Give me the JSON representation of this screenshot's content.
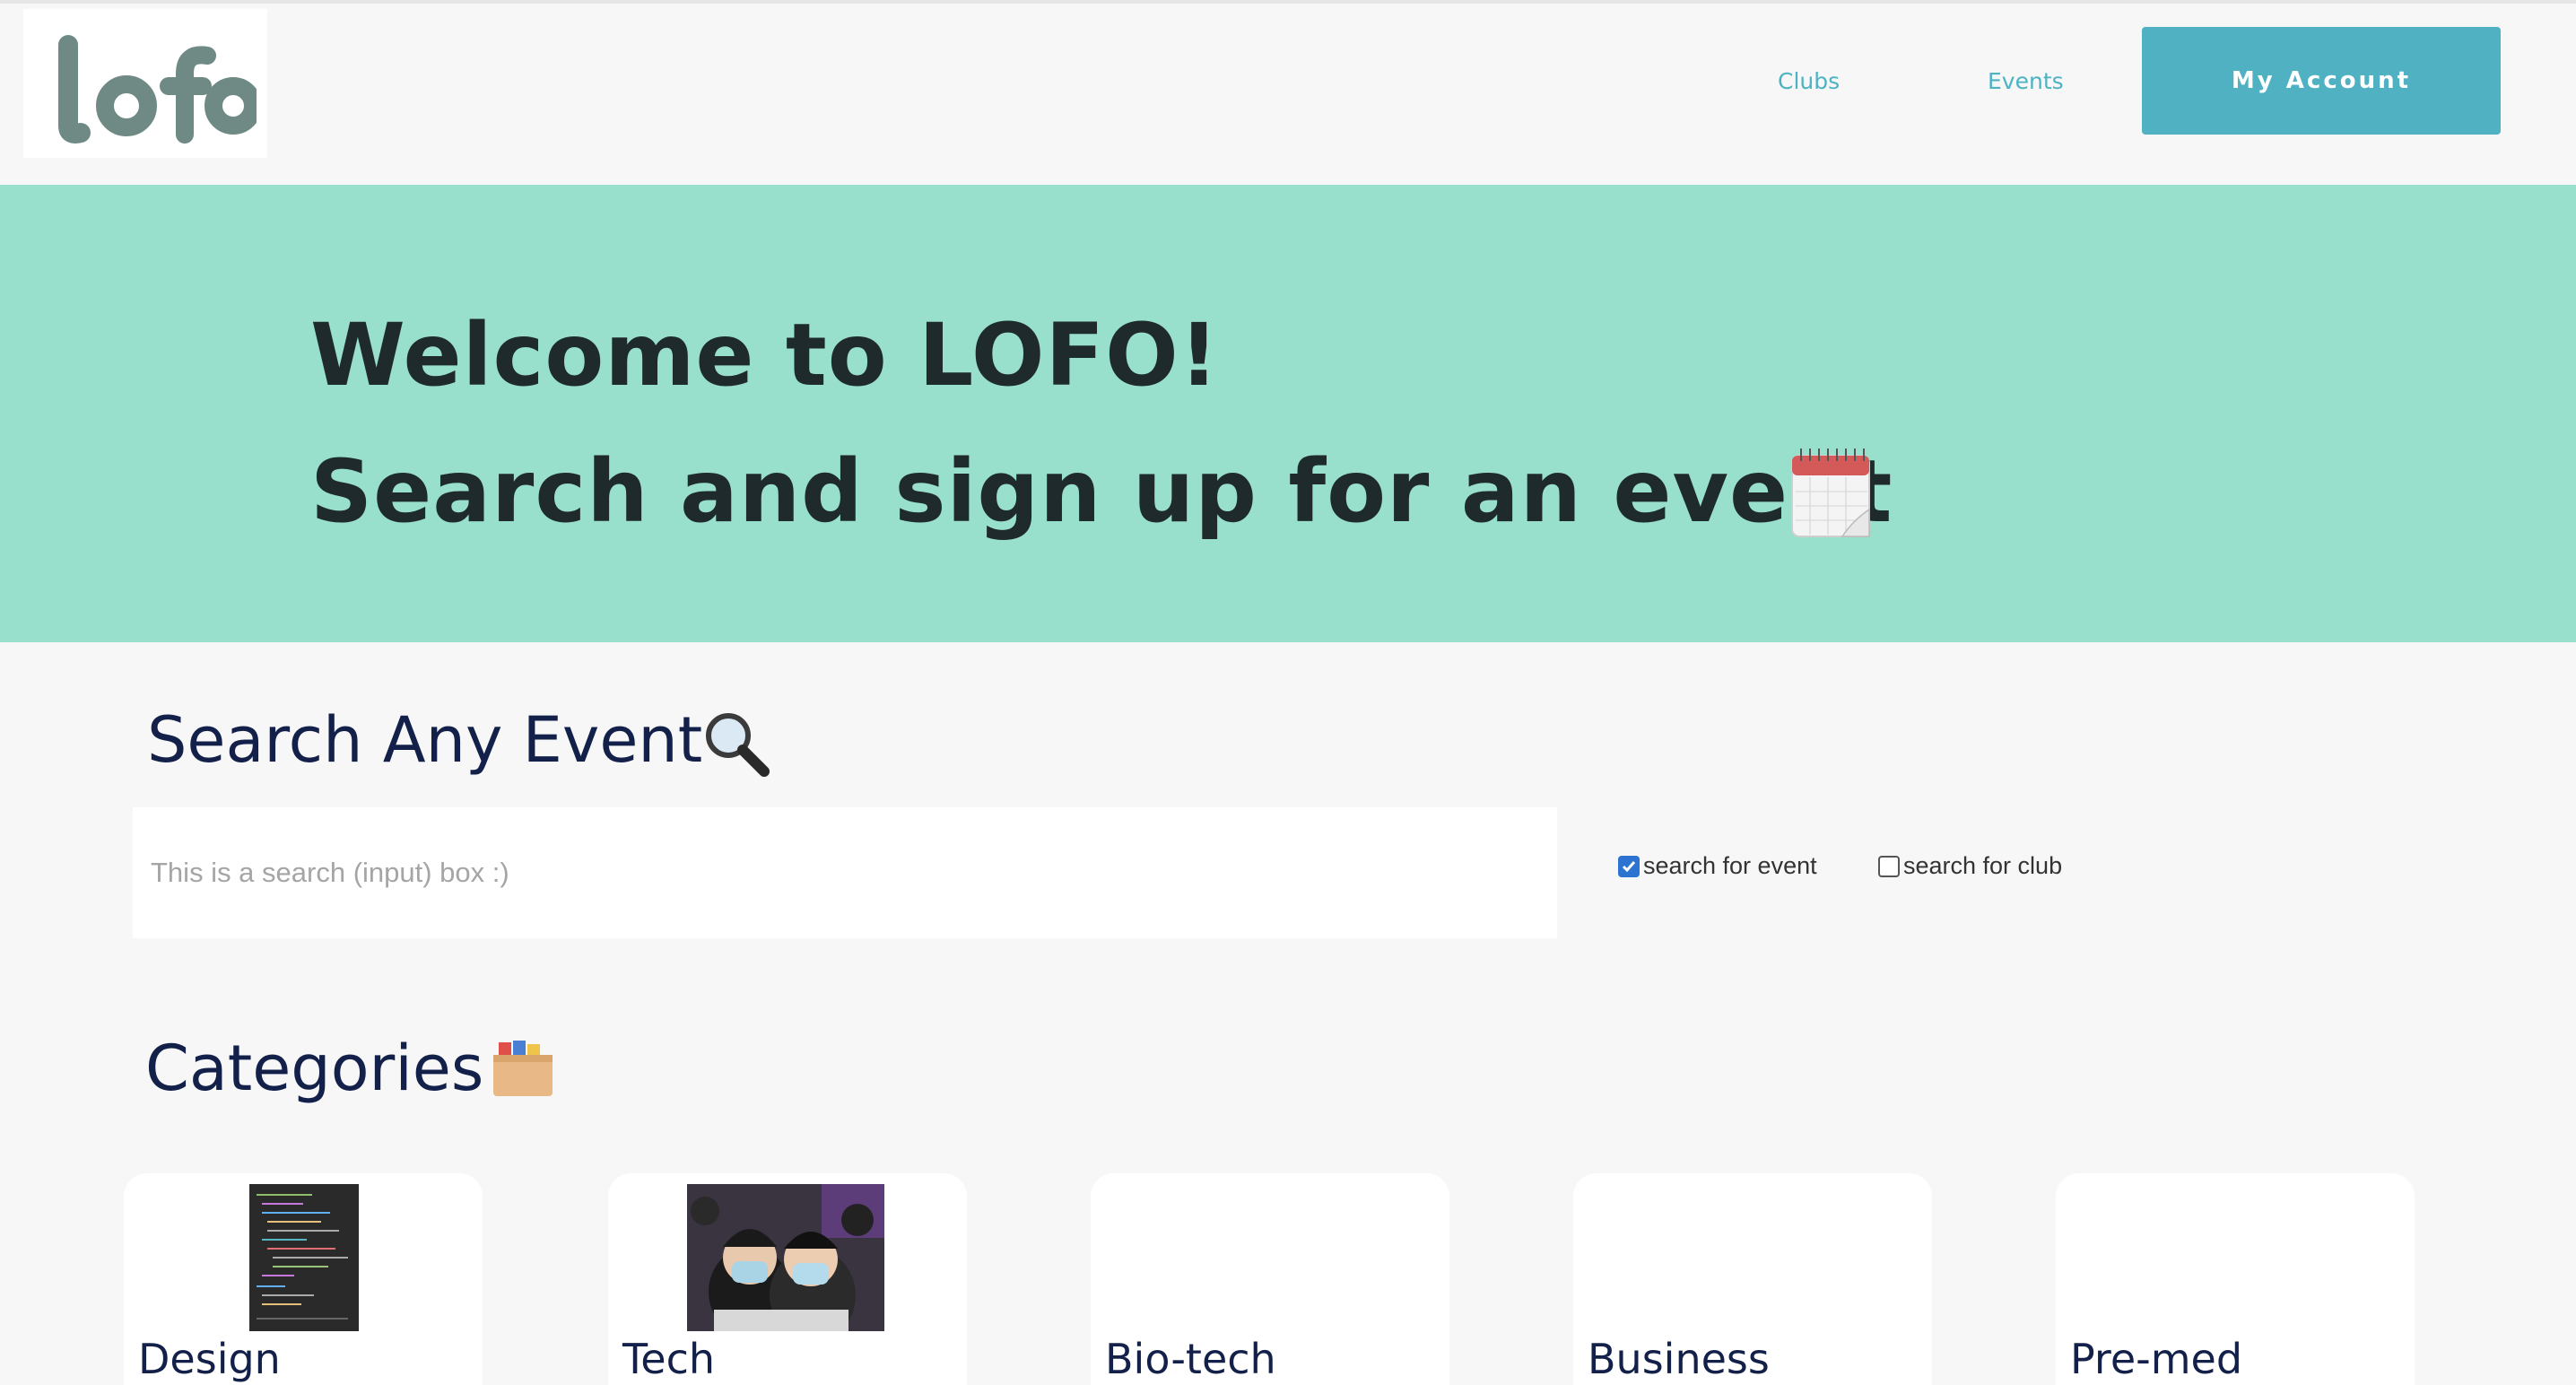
{
  "header": {
    "logo_text": "lofo",
    "nav": {
      "clubs": "Clubs",
      "events": "Events"
    },
    "account_button": "My Account"
  },
  "hero": {
    "line1": "Welcome to LOFO!",
    "line2": "Search and sign up for an event"
  },
  "search": {
    "title": "Search Any Event",
    "placeholder": "This is a search (input) box :)",
    "options": [
      {
        "label": "search for event",
        "checked": true
      },
      {
        "label": "search for club",
        "checked": false
      }
    ]
  },
  "categories": {
    "title": "Categories",
    "items": [
      {
        "label": "Design"
      },
      {
        "label": "Tech"
      },
      {
        "label": "Bio-tech"
      },
      {
        "label": "Business"
      },
      {
        "label": "Pre-med"
      }
    ]
  },
  "colors": {
    "accent": "#50b1c3",
    "hero_bg": "#98dfcc",
    "heading": "#13214a"
  }
}
